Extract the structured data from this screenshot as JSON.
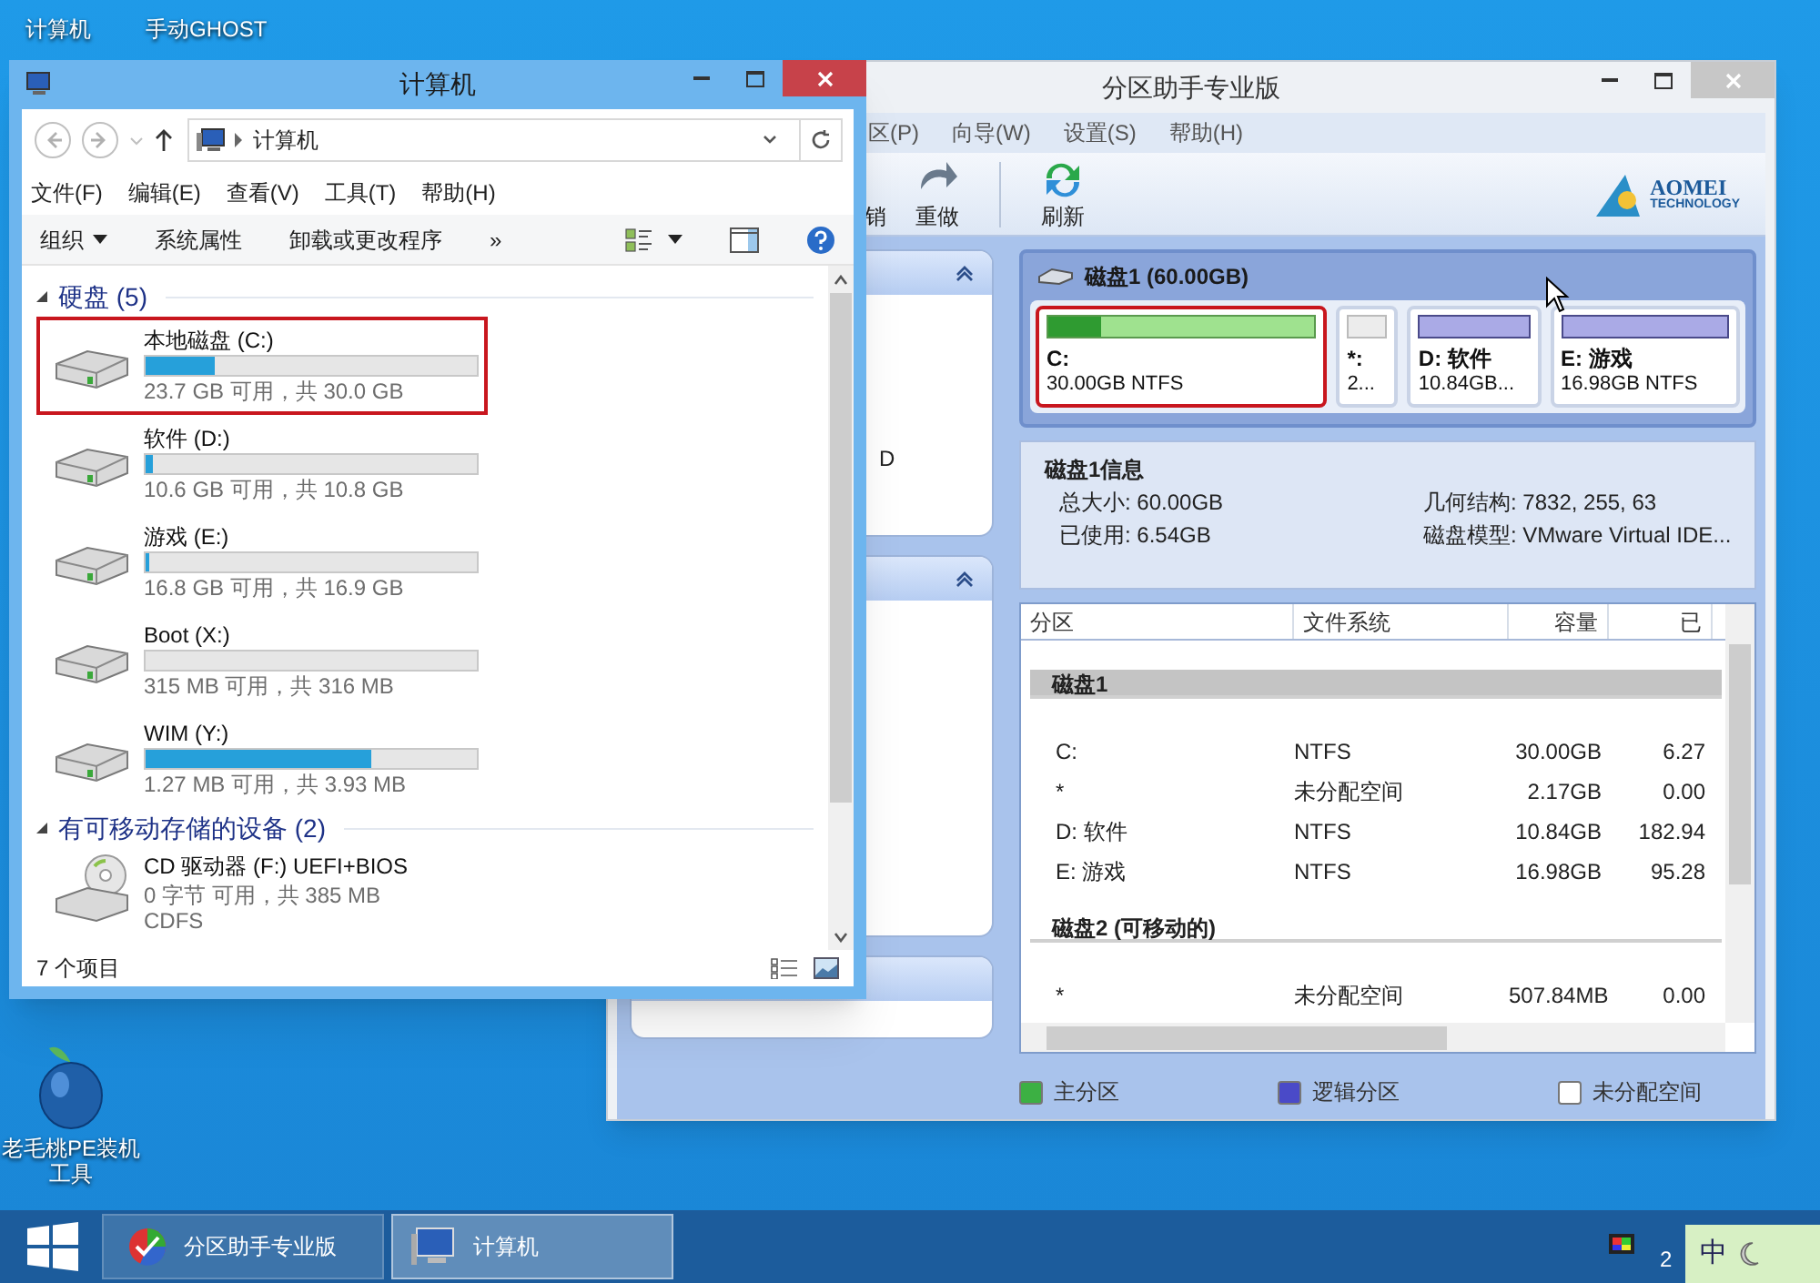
{
  "desktop_icons": [
    {
      "label": "计算机"
    },
    {
      "label": "手动GHOST"
    }
  ],
  "desktop_app": {
    "label": "老毛桃PE装机工具"
  },
  "partition_assistant": {
    "title": "分区助手专业版",
    "menu": [
      "区(P)",
      "向导(W)",
      "设置(S)",
      "帮助(H)"
    ],
    "toolbar": [
      {
        "kind": "undo",
        "label": "销"
      },
      {
        "kind": "redo",
        "label": "重做"
      },
      {
        "kind": "refresh",
        "label": "刷新"
      }
    ],
    "logo": {
      "name": "AOMEI",
      "tagline": "TECHNOLOGY"
    },
    "side_text": "D",
    "disk_map": {
      "title": "磁盘1 (60.00GB)",
      "partitions": [
        {
          "kind": "primary",
          "name": "C:",
          "detail": "30.00GB NTFS",
          "level": 0.2,
          "selected": true
        },
        {
          "kind": "unallocated",
          "name": "*:",
          "detail": "2...",
          "selected": false
        },
        {
          "kind": "logical",
          "name": "D: 软件",
          "detail": "10.84GB...",
          "selected": false
        },
        {
          "kind": "logical",
          "name": "E: 游戏",
          "detail": "16.98GB NTFS",
          "selected": false
        }
      ]
    },
    "disk_info": {
      "title": "磁盘1信息",
      "left": [
        "总大小: 60.00GB",
        "已使用: 6.54GB"
      ],
      "right": [
        "几何结构: 7832, 255, 63",
        "磁盘模型: VMware Virtual IDE..."
      ]
    },
    "table": {
      "columns": [
        "分区",
        "文件系统",
        "容量",
        "已"
      ],
      "groups": [
        {
          "label": "磁盘1",
          "shaded": true,
          "rows": [
            [
              "C:",
              "NTFS",
              "30.00GB",
              "6.27"
            ],
            [
              "*",
              "未分配空间",
              "2.17GB",
              "0.00"
            ],
            [
              "D: 软件",
              "NTFS",
              "10.84GB",
              "182.94"
            ],
            [
              "E: 游戏",
              "NTFS",
              "16.98GB",
              "95.28"
            ]
          ]
        },
        {
          "label": "磁盘2 (可移动的)",
          "shaded": false,
          "rows": [
            [
              "*",
              "未分配空间",
              "507.84MB",
              "0.00"
            ]
          ]
        }
      ]
    },
    "legend": [
      {
        "label": "主分区",
        "color": "#3cb043"
      },
      {
        "label": "逻辑分区",
        "color": "#4a4ac8"
      },
      {
        "label": "未分配空间",
        "color": "#ffffff"
      }
    ]
  },
  "explorer": {
    "title": "计算机",
    "breadcrumb": "计算机",
    "menu": [
      "文件(F)",
      "编辑(E)",
      "查看(V)",
      "工具(T)",
      "帮助(H)"
    ],
    "commands": [
      {
        "label": "组织",
        "dropdown": true
      },
      {
        "label": "系统属性",
        "dropdown": false
      },
      {
        "label": "卸载或更改程序",
        "dropdown": false
      },
      {
        "label": "»",
        "dropdown": false
      }
    ],
    "groups": [
      {
        "label": "硬盘 (5)",
        "drives": [
          {
            "kind": "disk",
            "name": "本地磁盘 (C:)",
            "level": 0.21,
            "info": "23.7 GB 可用，共 30.0 GB",
            "highlighted": true
          },
          {
            "kind": "disk",
            "name": "软件 (D:)",
            "level": 0.02,
            "info": "10.6 GB 可用，共 10.8 GB",
            "highlighted": false
          },
          {
            "kind": "disk",
            "name": "游戏 (E:)",
            "level": 0.01,
            "info": "16.8 GB 可用，共 16.9 GB",
            "highlighted": false
          },
          {
            "kind": "disk",
            "name": "Boot (X:)",
            "level": 0,
            "info": "315 MB 可用，共 316 MB",
            "highlighted": false
          },
          {
            "kind": "disk",
            "name": "WIM (Y:)",
            "level": 0.68,
            "info": "1.27 MB 可用，共 3.93 MB",
            "highlighted": false
          }
        ]
      },
      {
        "label": "有可移动存储的设备 (2)",
        "drives": [
          {
            "kind": "optical",
            "name": "CD 驱动器 (F:) UEFI+BIOS",
            "info": "0 字节 可用，共 385 MB",
            "fs": "CDFS",
            "highlighted": false
          }
        ]
      }
    ],
    "status": "7 个项目"
  },
  "taskbar": {
    "buttons": [
      {
        "kind": "partition",
        "label": "分区助手专业版",
        "selected": false
      },
      {
        "kind": "computer",
        "label": "计算机",
        "selected": true
      }
    ],
    "ime": "中",
    "clock": "2"
  }
}
